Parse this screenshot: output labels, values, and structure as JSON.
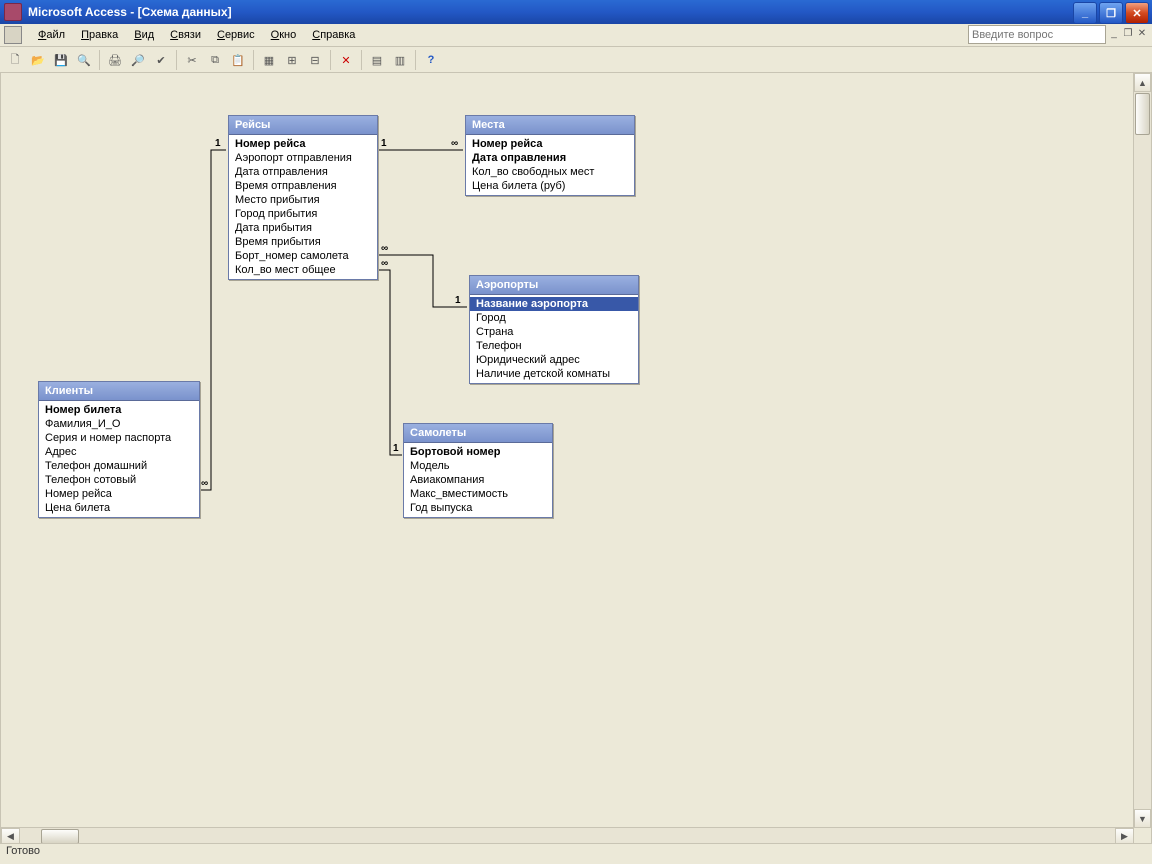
{
  "title": "Microsoft Access - [Схема данных]",
  "menu": {
    "file": "Файл",
    "edit": "Правка",
    "view": "Вид",
    "relations": "Связи",
    "service": "Сервис",
    "window": "Окно",
    "help": "Справка"
  },
  "askbox_placeholder": "Введите вопрос",
  "status": "Готово",
  "tables": {
    "flights": {
      "title": "Рейсы",
      "fields": [
        "Номер рейса",
        "Аэропорт отправления",
        "Дата отправления",
        "Время отправления",
        "Место прибытия",
        "Город прибытия",
        "Дата прибытия",
        "Время прибытия",
        "Борт_номер самолета",
        "Кол_во мест общее"
      ],
      "keys": [
        0
      ]
    },
    "seats": {
      "title": "Места",
      "fields": [
        "Номер рейса",
        "Дата оправления",
        "Кол_во свободных мест",
        "Цена билета (руб)"
      ],
      "keys": [
        0,
        1
      ]
    },
    "clients": {
      "title": "Клиенты",
      "fields": [
        "Номер билета",
        "Фамилия_И_О",
        "Серия и номер паспорта",
        "Адрес",
        "Телефон домашний",
        "Телефон сотовый",
        "Номер рейса",
        "Цена билета"
      ],
      "keys": [
        0
      ]
    },
    "airports": {
      "title": "Аэропорты",
      "fields": [
        "Название аэропорта",
        "Город",
        "Страна",
        "Телефон",
        "Юридический адрес",
        "Наличие детской комнаты"
      ],
      "keys": [
        0
      ],
      "selected": 0
    },
    "planes": {
      "title": "Самолеты",
      "fields": [
        "Бортовой номер",
        "Модель",
        "Авиакомпания",
        "Макс_вместимость",
        "Год выпуска"
      ],
      "keys": [
        0
      ]
    }
  },
  "relations": [
    {
      "from": "flights",
      "to": "seats",
      "card_from": "1",
      "card_to": "∞"
    },
    {
      "from": "flights",
      "to": "clients",
      "card_from": "1",
      "card_to": "∞"
    },
    {
      "from": "flights",
      "to": "airports",
      "card_from": "∞",
      "card_to": "1"
    },
    {
      "from": "flights",
      "to": "planes",
      "card_from": "∞",
      "card_to": "1"
    }
  ]
}
